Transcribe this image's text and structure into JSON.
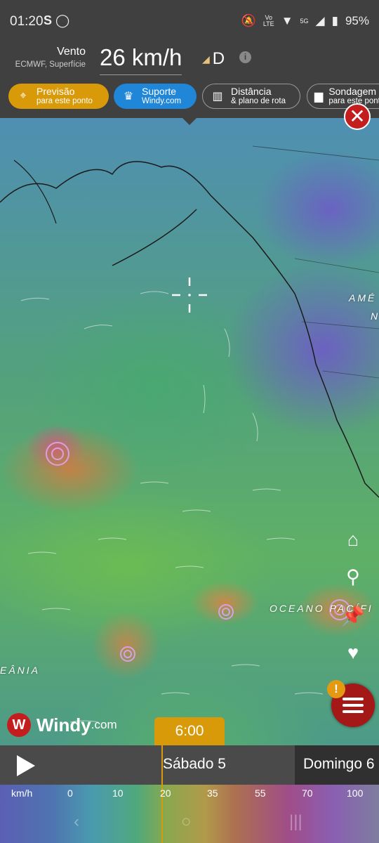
{
  "status_bar": {
    "time": "01:20",
    "left_icons": "S ◯",
    "battery": "95%",
    "right_icons": [
      "mute-icon",
      "volte-icon",
      "wifi-icon",
      "5g-icon",
      "signal-icon",
      "battery-icon"
    ]
  },
  "header": {
    "title": "Vento",
    "subtitle": "ECMWF, Superfície",
    "value": "26 km/h",
    "direction": "D"
  },
  "chips": [
    {
      "l1": "Previsão",
      "l2": "para este ponto",
      "icon": "target-icon"
    },
    {
      "l1": "Suporte",
      "l2": "Windy.com",
      "icon": "crown-icon"
    },
    {
      "l1": "Distância",
      "l2": "& plano de rota",
      "icon": "ruler-icon"
    },
    {
      "l1": "Sondagem",
      "l2": "para este ponto",
      "icon": "bar-chart-icon"
    }
  ],
  "map": {
    "labels": {
      "america": "AMÉ",
      "america2": "N",
      "ocean": "OCEANO PACÍFI",
      "oceania": "EÂNIA"
    }
  },
  "logo": {
    "name": "Windy",
    "tld": ".com"
  },
  "timeline": {
    "time": "6:00",
    "day1": "Sábado 5",
    "day2": "Domingo 6"
  },
  "scale": {
    "unit": "km/h",
    "ticks": [
      "0",
      "10",
      "20",
      "35",
      "55",
      "70",
      "100"
    ]
  },
  "colors": {
    "accent": "#d99a0a",
    "support": "#1f86d8",
    "close": "#c41d1d"
  }
}
